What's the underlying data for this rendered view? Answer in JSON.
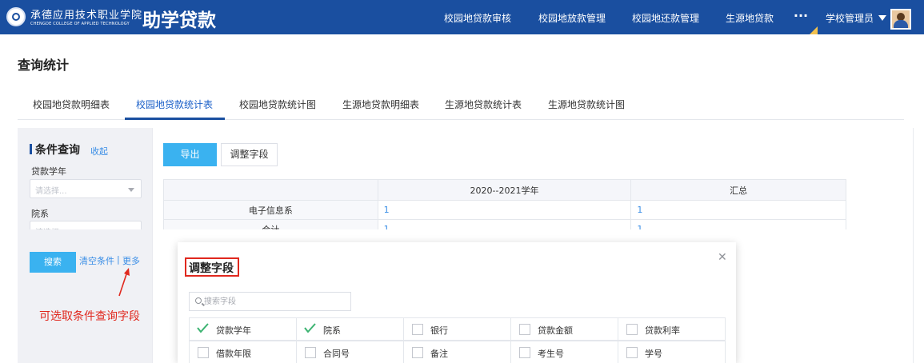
{
  "header": {
    "school_name": "承德应用技术职业学院",
    "school_name_en": "CHENGDE COLLEGE OF APPLIED TECHNOLOGY",
    "app_title": "助学贷款",
    "nav": [
      "校园地贷款审核",
      "校园地放款管理",
      "校园地还款管理",
      "生源地贷款"
    ],
    "more": "···",
    "user": "学校管理员"
  },
  "page": {
    "title": "查询统计",
    "tabs": [
      "校园地贷款明细表",
      "校园地贷款统计表",
      "校园地贷款统计图",
      "生源地贷款明细表",
      "生源地贷款统计表",
      "生源地贷款统计图"
    ],
    "active_tab": "校园地贷款统计表"
  },
  "filter": {
    "title": "条件查询",
    "collapse": "收起",
    "fields": [
      {
        "label": "贷款学年",
        "placeholder": "请选择..."
      },
      {
        "label": "院系",
        "placeholder": "请选择..."
      }
    ],
    "search_btn": "搜索",
    "clear": "清空条件",
    "sep": "|",
    "more": "更多"
  },
  "annotation": "可选取条件查询字段",
  "toolbar": {
    "export": "导出",
    "adjust": "调整字段"
  },
  "table": {
    "columns": [
      "",
      "2020--2021学年",
      "汇总"
    ],
    "rows": [
      {
        "name": "电子信息系",
        "values": [
          "1",
          "1"
        ]
      },
      {
        "name": "合计",
        "values": [
          "1",
          "1"
        ]
      }
    ]
  },
  "modal": {
    "title": "调整字段",
    "search_placeholder": "搜索字段",
    "fields": [
      {
        "label": "贷款学年",
        "checked": true
      },
      {
        "label": "院系",
        "checked": true
      },
      {
        "label": "银行",
        "checked": false
      },
      {
        "label": "贷款金额",
        "checked": false
      },
      {
        "label": "贷款利率",
        "checked": false
      },
      {
        "label": "借款年限",
        "checked": false
      },
      {
        "label": "合同号",
        "checked": false
      },
      {
        "label": "备注",
        "checked": false
      },
      {
        "label": "考生号",
        "checked": false
      },
      {
        "label": "学号",
        "checked": false
      }
    ]
  },
  "colors": {
    "topbar": "#1a4fa0",
    "accent": "#3ab2f0",
    "link": "#3a8ee6",
    "annotation": "#e0281e",
    "check": "#3cb371"
  }
}
